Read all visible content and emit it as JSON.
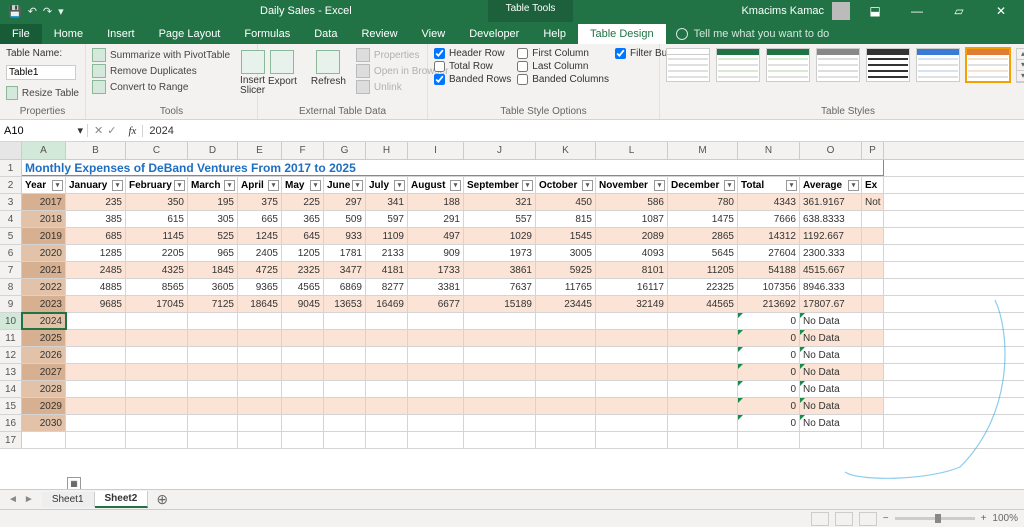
{
  "app": {
    "doc_title": "Daily Sales - Excel",
    "table_tools": "Table Tools",
    "user": "Kmacims Kamac"
  },
  "qat": {
    "save": "💾",
    "undo": "↶",
    "redo": "↷",
    "more": "▾"
  },
  "winbtns": {
    "min": "—",
    "max": "▱",
    "close": "✕",
    "ribbonmin": "⬓"
  },
  "menus": {
    "file": "File",
    "home": "Home",
    "insert": "Insert",
    "pagelayout": "Page Layout",
    "formulas": "Formulas",
    "data": "Data",
    "review": "Review",
    "view": "View",
    "developer": "Developer",
    "help": "Help",
    "tabledesign": "Table Design",
    "tell": "Tell me what you want to do"
  },
  "ribbon": {
    "properties": {
      "tablename_label": "Table Name:",
      "tablename_value": "Table1",
      "resize": "Resize Table",
      "g_label": "Properties"
    },
    "tools": {
      "pivot": "Summarize with PivotTable",
      "dupes": "Remove Duplicates",
      "range": "Convert to Range",
      "slicer": "Insert\nSlicer",
      "g_label": "Tools"
    },
    "external": {
      "export": "Export",
      "refresh": "Refresh",
      "props": "Properties",
      "browser": "Open in Browser",
      "unlink": "Unlink",
      "g_label": "External Table Data"
    },
    "styleopts": {
      "headerrow": "Header Row",
      "totalrow": "Total Row",
      "banded": "Banded Rows",
      "firstcol": "First Column",
      "lastcol": "Last Column",
      "bandedcols": "Banded Columns",
      "filter": "Filter Button",
      "g_label": "Table Style Options"
    },
    "styles": {
      "g_label": "Table Styles"
    }
  },
  "formulabar": {
    "name": "A10",
    "content": "2024",
    "cancel": "✕",
    "enter": "✓",
    "fx": "fx",
    "dd": "▾"
  },
  "workbook": {
    "title": "Monthly Expenses of DeBand Ventures From 2017 to 2025"
  },
  "columns": {
    "headers": [
      "Year",
      "January",
      "February",
      "March",
      "April",
      "May",
      "June",
      "July",
      "August",
      "September",
      "October",
      "November",
      "December",
      "Total",
      "Average",
      "Ex"
    ],
    "last_visible": "Not"
  },
  "rows": [
    {
      "year": "2017",
      "vals": [
        "235",
        "350",
        "195",
        "375",
        "225",
        "297",
        "341",
        "188",
        "321",
        "450",
        "586",
        "780",
        "4343",
        "361.9167"
      ]
    },
    {
      "year": "2018",
      "vals": [
        "385",
        "615",
        "305",
        "665",
        "365",
        "509",
        "597",
        "291",
        "557",
        "815",
        "1087",
        "1475",
        "7666",
        "638.8333"
      ]
    },
    {
      "year": "2019",
      "vals": [
        "685",
        "1145",
        "525",
        "1245",
        "645",
        "933",
        "1109",
        "497",
        "1029",
        "1545",
        "2089",
        "2865",
        "14312",
        "1192.667"
      ]
    },
    {
      "year": "2020",
      "vals": [
        "1285",
        "2205",
        "965",
        "2405",
        "1205",
        "1781",
        "2133",
        "909",
        "1973",
        "3005",
        "4093",
        "5645",
        "27604",
        "2300.333"
      ]
    },
    {
      "year": "2021",
      "vals": [
        "2485",
        "4325",
        "1845",
        "4725",
        "2325",
        "3477",
        "4181",
        "1733",
        "3861",
        "5925",
        "8101",
        "11205",
        "54188",
        "4515.667"
      ]
    },
    {
      "year": "2022",
      "vals": [
        "4885",
        "8565",
        "3605",
        "9365",
        "4565",
        "6869",
        "8277",
        "3381",
        "7637",
        "11765",
        "16117",
        "22325",
        "107356",
        "8946.333"
      ]
    },
    {
      "year": "2023",
      "vals": [
        "9685",
        "17045",
        "7125",
        "18645",
        "9045",
        "13653",
        "16469",
        "6677",
        "15189",
        "23445",
        "32149",
        "44565",
        "213692",
        "17807.67"
      ]
    },
    {
      "year": "2024",
      "vals": [
        "",
        "",
        "",
        "",
        "",
        "",
        "",
        "",
        "",
        "",
        "",
        "",
        "0",
        "No Data"
      ]
    },
    {
      "year": "2025",
      "vals": [
        "",
        "",
        "",
        "",
        "",
        "",
        "",
        "",
        "",
        "",
        "",
        "",
        "0",
        "No Data"
      ]
    },
    {
      "year": "2026",
      "vals": [
        "",
        "",
        "",
        "",
        "",
        "",
        "",
        "",
        "",
        "",
        "",
        "",
        "0",
        "No Data"
      ]
    },
    {
      "year": "2027",
      "vals": [
        "",
        "",
        "",
        "",
        "",
        "",
        "",
        "",
        "",
        "",
        "",
        "",
        "0",
        "No Data"
      ]
    },
    {
      "year": "2028",
      "vals": [
        "",
        "",
        "",
        "",
        "",
        "",
        "",
        "",
        "",
        "",
        "",
        "",
        "0",
        "No Data"
      ]
    },
    {
      "year": "2029",
      "vals": [
        "",
        "",
        "",
        "",
        "",
        "",
        "",
        "",
        "",
        "",
        "",
        "",
        "0",
        "No Data"
      ]
    },
    {
      "year": "2030",
      "vals": [
        "",
        "",
        "",
        "",
        "",
        "",
        "",
        "",
        "",
        "",
        "",
        "",
        "0",
        "No Data"
      ]
    }
  ],
  "col_letters": [
    "A",
    "B",
    "C",
    "D",
    "E",
    "F",
    "G",
    "H",
    "I",
    "J",
    "K",
    "L",
    "M",
    "N",
    "O",
    "P"
  ],
  "col_classes": [
    "c-A",
    "c-B",
    "c-C",
    "c-D",
    "c-E",
    "c-F",
    "c-G",
    "c-H",
    "c-I",
    "c-J",
    "c-K",
    "c-L",
    "c-M",
    "c-N",
    "c-O",
    "c-P"
  ],
  "sheets": {
    "s1": "Sheet1",
    "s2": "Sheet2",
    "add": "⊕",
    "nav_l": "◄",
    "nav_r": "►"
  },
  "status": {
    "zoom": "100%",
    "plus": "+",
    "minus": "−"
  }
}
